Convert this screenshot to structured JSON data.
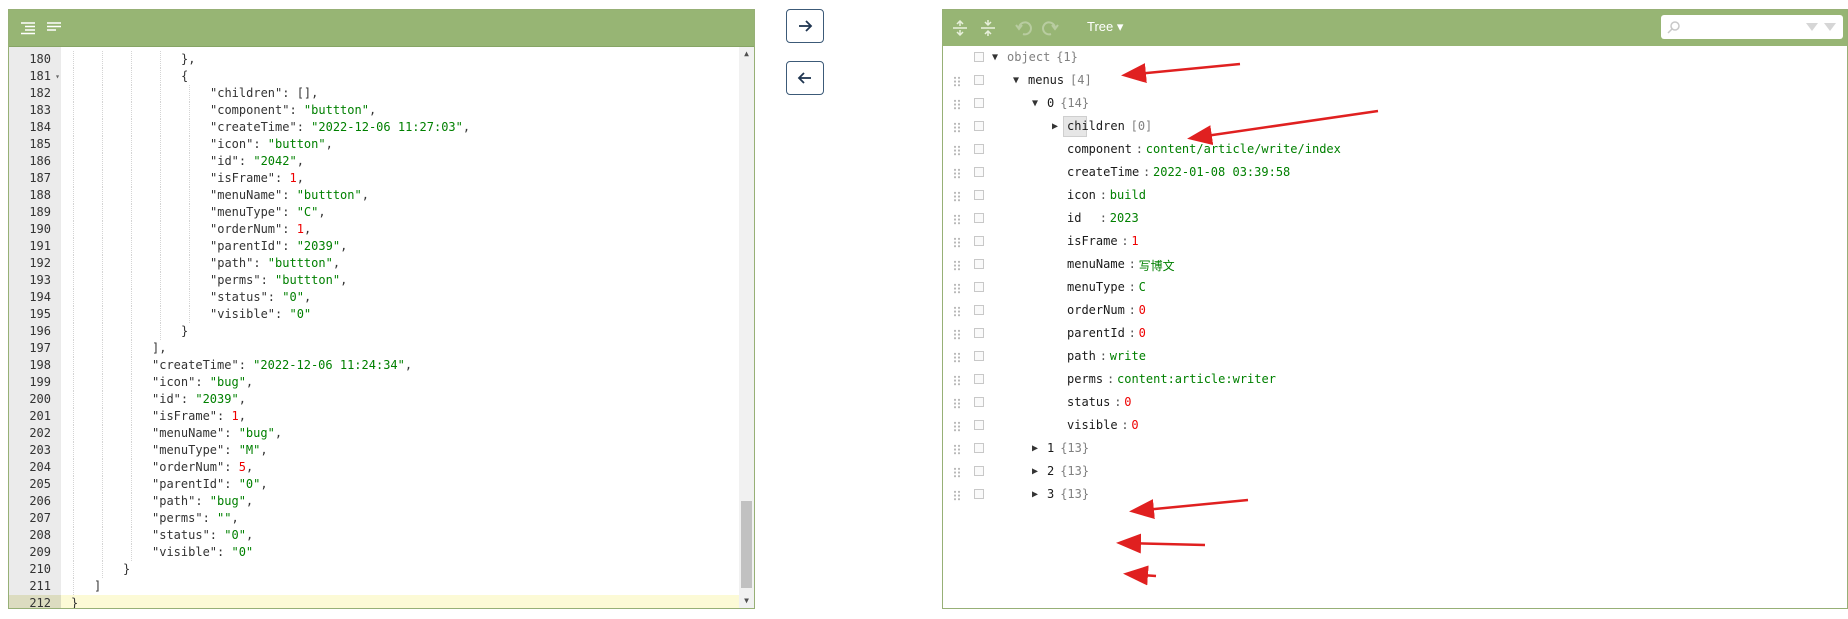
{
  "left_editor": {
    "menubar": {
      "format_icon": "format-icon",
      "compact_icon": "compact-icon"
    },
    "lines": [
      {
        "num": "180",
        "tokens": [
          {
            "t": "k",
            "v": "},"
          }
        ],
        "indent": 4
      },
      {
        "num": "181",
        "fold": "▾",
        "tokens": [
          {
            "t": "k",
            "v": "{"
          }
        ],
        "indent": 4
      },
      {
        "num": "182",
        "tokens": [
          {
            "t": "k",
            "v": "\"children\": [],"
          }
        ],
        "indent": 5
      },
      {
        "num": "183",
        "tokens": [
          {
            "t": "k",
            "v": "\"component\": "
          },
          {
            "t": "s",
            "v": "\"buttton\""
          },
          {
            "t": "k",
            "v": ","
          }
        ],
        "indent": 5
      },
      {
        "num": "184",
        "tokens": [
          {
            "t": "k",
            "v": "\"createTime\": "
          },
          {
            "t": "s",
            "v": "\"2022-12-06 11:27:03\""
          },
          {
            "t": "k",
            "v": ","
          }
        ],
        "indent": 5
      },
      {
        "num": "185",
        "tokens": [
          {
            "t": "k",
            "v": "\"icon\": "
          },
          {
            "t": "s",
            "v": "\"button\""
          },
          {
            "t": "k",
            "v": ","
          }
        ],
        "indent": 5
      },
      {
        "num": "186",
        "tokens": [
          {
            "t": "k",
            "v": "\"id\": "
          },
          {
            "t": "s",
            "v": "\"2042\""
          },
          {
            "t": "k",
            "v": ","
          }
        ],
        "indent": 5
      },
      {
        "num": "187",
        "tokens": [
          {
            "t": "k",
            "v": "\"isFrame\": "
          },
          {
            "t": "n",
            "v": "1"
          },
          {
            "t": "k",
            "v": ","
          }
        ],
        "indent": 5
      },
      {
        "num": "188",
        "tokens": [
          {
            "t": "k",
            "v": "\"menuName\": "
          },
          {
            "t": "s",
            "v": "\"buttton\""
          },
          {
            "t": "k",
            "v": ","
          }
        ],
        "indent": 5
      },
      {
        "num": "189",
        "tokens": [
          {
            "t": "k",
            "v": "\"menuType\": "
          },
          {
            "t": "s",
            "v": "\"C\""
          },
          {
            "t": "k",
            "v": ","
          }
        ],
        "indent": 5
      },
      {
        "num": "190",
        "tokens": [
          {
            "t": "k",
            "v": "\"orderNum\": "
          },
          {
            "t": "n",
            "v": "1"
          },
          {
            "t": "k",
            "v": ","
          }
        ],
        "indent": 5
      },
      {
        "num": "191",
        "tokens": [
          {
            "t": "k",
            "v": "\"parentId\": "
          },
          {
            "t": "s",
            "v": "\"2039\""
          },
          {
            "t": "k",
            "v": ","
          }
        ],
        "indent": 5
      },
      {
        "num": "192",
        "tokens": [
          {
            "t": "k",
            "v": "\"path\": "
          },
          {
            "t": "s",
            "v": "\"buttton\""
          },
          {
            "t": "k",
            "v": ","
          }
        ],
        "indent": 5
      },
      {
        "num": "193",
        "tokens": [
          {
            "t": "k",
            "v": "\"perms\": "
          },
          {
            "t": "s",
            "v": "\"buttton\""
          },
          {
            "t": "k",
            "v": ","
          }
        ],
        "indent": 5
      },
      {
        "num": "194",
        "tokens": [
          {
            "t": "k",
            "v": "\"status\": "
          },
          {
            "t": "s",
            "v": "\"0\""
          },
          {
            "t": "k",
            "v": ","
          }
        ],
        "indent": 5
      },
      {
        "num": "195",
        "tokens": [
          {
            "t": "k",
            "v": "\"visible\": "
          },
          {
            "t": "s",
            "v": "\"0\""
          }
        ],
        "indent": 5
      },
      {
        "num": "196",
        "tokens": [
          {
            "t": "k",
            "v": "}"
          }
        ],
        "indent": 4
      },
      {
        "num": "197",
        "tokens": [
          {
            "t": "k",
            "v": "],"
          }
        ],
        "indent": 3
      },
      {
        "num": "198",
        "tokens": [
          {
            "t": "k",
            "v": "\"createTime\": "
          },
          {
            "t": "s",
            "v": "\"2022-12-06 11:24:34\""
          },
          {
            "t": "k",
            "v": ","
          }
        ],
        "indent": 3
      },
      {
        "num": "199",
        "tokens": [
          {
            "t": "k",
            "v": "\"icon\": "
          },
          {
            "t": "s",
            "v": "\"bug\""
          },
          {
            "t": "k",
            "v": ","
          }
        ],
        "indent": 3
      },
      {
        "num": "200",
        "tokens": [
          {
            "t": "k",
            "v": "\"id\": "
          },
          {
            "t": "s",
            "v": "\"2039\""
          },
          {
            "t": "k",
            "v": ","
          }
        ],
        "indent": 3
      },
      {
        "num": "201",
        "tokens": [
          {
            "t": "k",
            "v": "\"isFrame\": "
          },
          {
            "t": "n",
            "v": "1"
          },
          {
            "t": "k",
            "v": ","
          }
        ],
        "indent": 3
      },
      {
        "num": "202",
        "tokens": [
          {
            "t": "k",
            "v": "\"menuName\": "
          },
          {
            "t": "s",
            "v": "\"bug\""
          },
          {
            "t": "k",
            "v": ","
          }
        ],
        "indent": 3
      },
      {
        "num": "203",
        "tokens": [
          {
            "t": "k",
            "v": "\"menuType\": "
          },
          {
            "t": "s",
            "v": "\"M\""
          },
          {
            "t": "k",
            "v": ","
          }
        ],
        "indent": 3
      },
      {
        "num": "204",
        "tokens": [
          {
            "t": "k",
            "v": "\"orderNum\": "
          },
          {
            "t": "n",
            "v": "5"
          },
          {
            "t": "k",
            "v": ","
          }
        ],
        "indent": 3
      },
      {
        "num": "205",
        "tokens": [
          {
            "t": "k",
            "v": "\"parentId\": "
          },
          {
            "t": "s",
            "v": "\"0\""
          },
          {
            "t": "k",
            "v": ","
          }
        ],
        "indent": 3
      },
      {
        "num": "206",
        "tokens": [
          {
            "t": "k",
            "v": "\"path\": "
          },
          {
            "t": "s",
            "v": "\"bug\""
          },
          {
            "t": "k",
            "v": ","
          }
        ],
        "indent": 3
      },
      {
        "num": "207",
        "tokens": [
          {
            "t": "k",
            "v": "\"perms\": "
          },
          {
            "t": "s",
            "v": "\"\""
          },
          {
            "t": "k",
            "v": ","
          }
        ],
        "indent": 3
      },
      {
        "num": "208",
        "tokens": [
          {
            "t": "k",
            "v": "\"status\": "
          },
          {
            "t": "s",
            "v": "\"0\""
          },
          {
            "t": "k",
            "v": ","
          }
        ],
        "indent": 3
      },
      {
        "num": "209",
        "tokens": [
          {
            "t": "k",
            "v": "\"visible\": "
          },
          {
            "t": "s",
            "v": "\"0\""
          }
        ],
        "indent": 3
      },
      {
        "num": "210",
        "tokens": [
          {
            "t": "k",
            "v": "}"
          }
        ],
        "indent": 2
      },
      {
        "num": "211",
        "tokens": [
          {
            "t": "k",
            "v": "]"
          }
        ],
        "indent": 1
      },
      {
        "num": "212",
        "tokens": [
          {
            "t": "k",
            "v": "}"
          }
        ],
        "indent": 0,
        "active": true
      }
    ]
  },
  "middle": {
    "copy_right_icon": "arrow-right-icon",
    "copy_left_icon": "arrow-left-icon"
  },
  "right_tree": {
    "mode_label": "Tree ▾",
    "rows": [
      {
        "level": 0,
        "expander": "▼",
        "name": "object",
        "count": "{1}",
        "type": "root"
      },
      {
        "level": 1,
        "expander": "▼",
        "name": "menus",
        "count": "[4]",
        "type": "node"
      },
      {
        "level": 2,
        "expander": "▼",
        "name": "0",
        "count": "{14}",
        "type": "node"
      },
      {
        "level": 3,
        "expander": "▶",
        "name": "children",
        "count": "[0]",
        "type": "node",
        "boxed": true
      },
      {
        "level": 3,
        "name": "component",
        "value": "content/article/write/index",
        "vt": "s"
      },
      {
        "level": 3,
        "name": "createTime",
        "value": "2022-01-08 03:39:58",
        "vt": "s"
      },
      {
        "level": 3,
        "name": "icon",
        "value": "build",
        "vt": "s"
      },
      {
        "level": 3,
        "name": "id  ",
        "value": "2023",
        "vt": "s"
      },
      {
        "level": 3,
        "name": "isFrame",
        "value": "1",
        "vt": "n"
      },
      {
        "level": 3,
        "name": "menuName",
        "value": "写博文",
        "vt": "s"
      },
      {
        "level": 3,
        "name": "menuType",
        "value": "C",
        "vt": "s"
      },
      {
        "level": 3,
        "name": "orderNum",
        "value": "0",
        "vt": "n"
      },
      {
        "level": 3,
        "name": "parentId",
        "value": "0",
        "vt": "n"
      },
      {
        "level": 3,
        "name": "path",
        "value": "write",
        "vt": "s"
      },
      {
        "level": 3,
        "name": "perms",
        "value": "content:article:writer",
        "vt": "s"
      },
      {
        "level": 3,
        "name": "status",
        "value": "0",
        "vt": "n"
      },
      {
        "level": 3,
        "name": "visible",
        "value": "0",
        "vt": "n"
      },
      {
        "level": 2,
        "expander": "▶",
        "name": "1",
        "count": "{13}",
        "type": "node"
      },
      {
        "level": 2,
        "expander": "▶",
        "name": "2",
        "count": "{13}",
        "type": "node"
      },
      {
        "level": 2,
        "expander": "▶",
        "name": "3",
        "count": "{13}",
        "type": "node"
      }
    ]
  },
  "colors": {
    "menubar_bg": "#97b574",
    "string": "#008000",
    "number": "#ee0000",
    "annotation_arrow": "#e02020"
  }
}
